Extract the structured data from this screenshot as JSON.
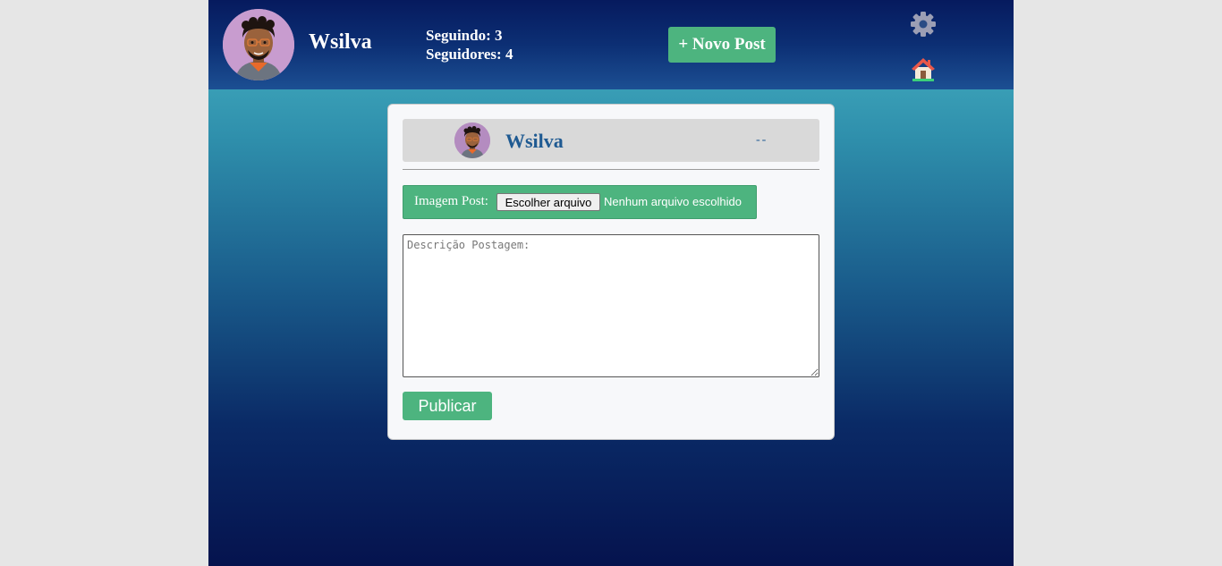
{
  "header": {
    "username": "Wsilva",
    "following": "Seguindo: 3",
    "followers": "Seguidores: 4",
    "new_post_label": "+ Novo Post",
    "settings_icon": "gear-icon",
    "home_icon": "home-icon"
  },
  "post_form": {
    "username": "Wsilva",
    "date": "--",
    "image_label": "Imagem Post:",
    "file_button": "Escolher arquivo",
    "file_status": "Nenhum arquivo escolhido",
    "description_placeholder": "Descrição Postagem:",
    "description_value": "",
    "publish_label": "Publicar"
  },
  "colors": {
    "accent_green": "#4db47f",
    "header_dark": "#061a5e",
    "name_blue": "#1f5a92"
  }
}
